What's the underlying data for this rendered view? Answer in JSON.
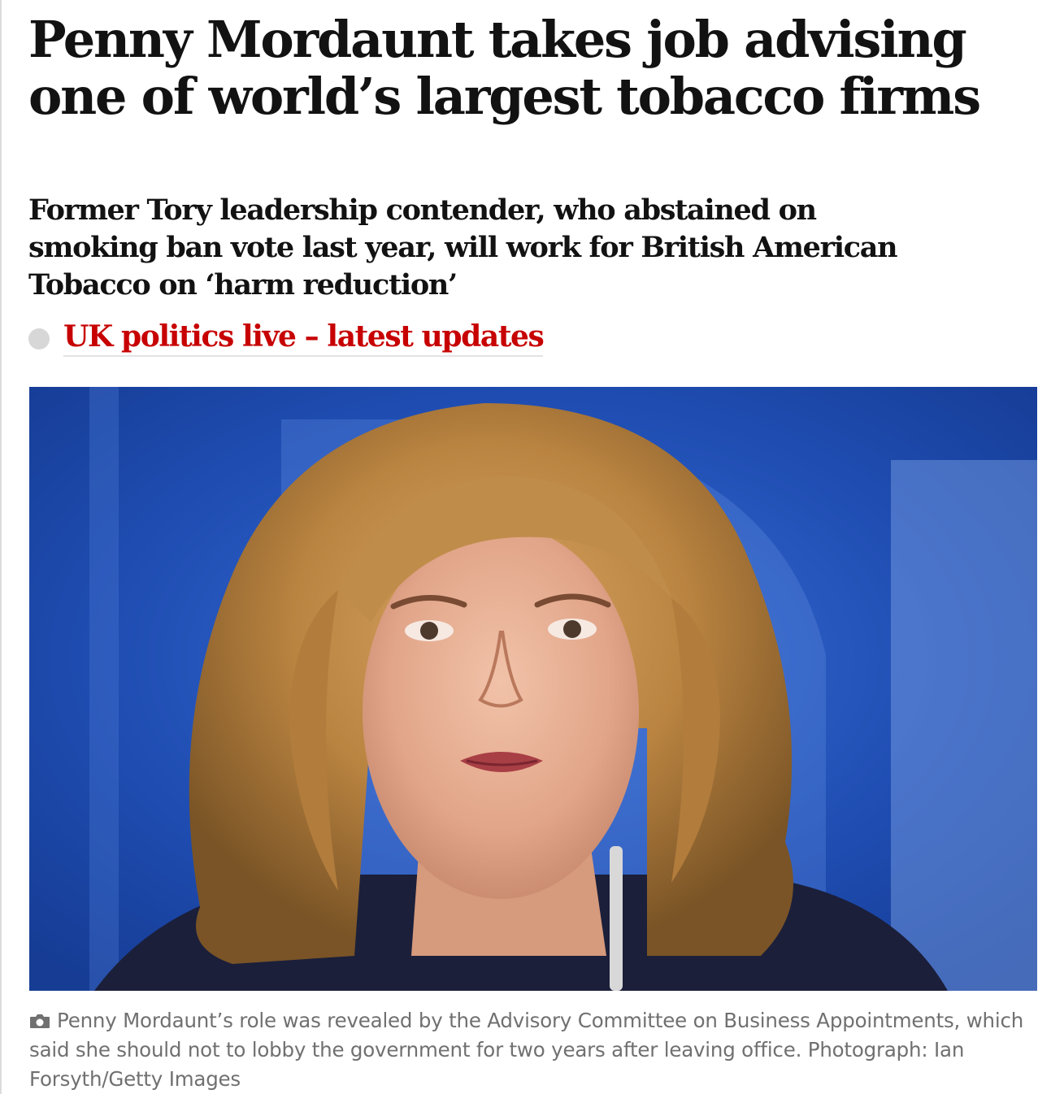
{
  "article": {
    "headline": "Penny Mordaunt takes job advising one of world’s largest tobacco firms",
    "standfirst": "Former Tory leadership contender, who abstained on smoking ban vote last year, will work for British American Tobacco on ‘harm reduction’",
    "live_link": "UK politics live – latest updates",
    "caption": "Penny Mordaunt’s role was revealed by the Advisory Committee on Business Appointments, which said she should not to lobby the government for two years after leaving office. Photograph: Ian Forsyth/Getty Images"
  },
  "colors": {
    "headline": "#121212",
    "live_link": "#c70000",
    "caption": "#707070",
    "photo_background": "#1e48a8"
  },
  "icons": {
    "live_indicator": "grey-dot-icon",
    "caption_icon": "camera-icon"
  }
}
